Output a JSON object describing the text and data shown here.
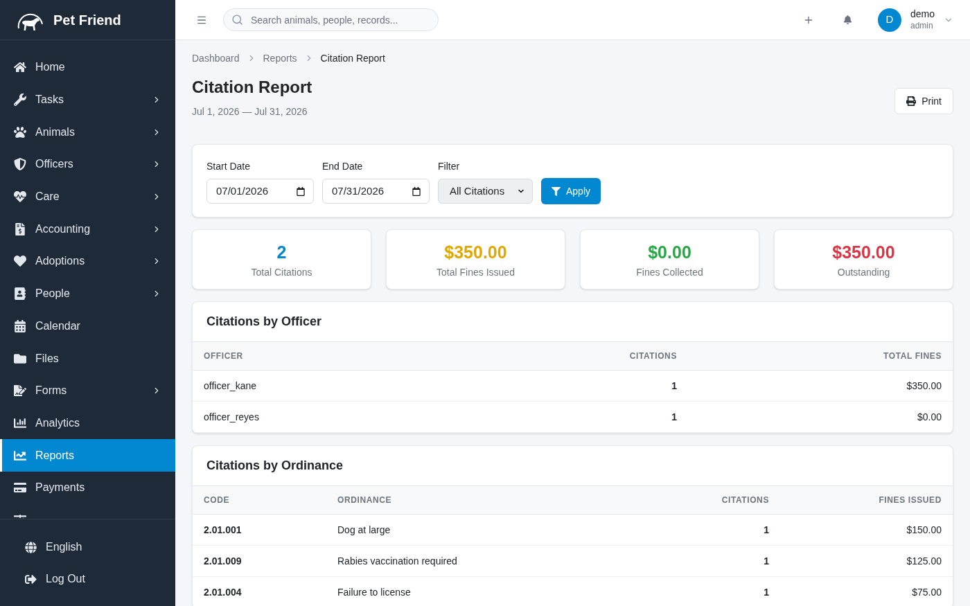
{
  "brand": {
    "name": "Pet Friend"
  },
  "sidebar": {
    "items": [
      {
        "label": "Home",
        "expandable": false,
        "selected": false
      },
      {
        "label": "Tasks",
        "expandable": true,
        "selected": false
      },
      {
        "label": "Animals",
        "expandable": true,
        "selected": false
      },
      {
        "label": "Officers",
        "expandable": true,
        "selected": false
      },
      {
        "label": "Care",
        "expandable": true,
        "selected": false
      },
      {
        "label": "Accounting",
        "expandable": true,
        "selected": false
      },
      {
        "label": "Adoptions",
        "expandable": true,
        "selected": false
      },
      {
        "label": "People",
        "expandable": true,
        "selected": false
      },
      {
        "label": "Calendar",
        "expandable": false,
        "selected": false
      },
      {
        "label": "Files",
        "expandable": false,
        "selected": false
      },
      {
        "label": "Forms",
        "expandable": true,
        "selected": false
      },
      {
        "label": "Analytics",
        "expandable": false,
        "selected": false
      },
      {
        "label": "Reports",
        "expandable": false,
        "selected": true
      },
      {
        "label": "Payments",
        "expandable": false,
        "selected": false
      },
      {
        "selected": false
      }
    ],
    "footer": [
      {
        "label": "English"
      },
      {
        "label": "Log Out"
      }
    ]
  },
  "topbar": {
    "search": {
      "placeholder": "Search animals, people, records..."
    },
    "user": {
      "initial": "D",
      "name": "demo",
      "role": "admin"
    }
  },
  "breadcrumb": [
    {
      "label": "Dashboard",
      "current": false
    },
    {
      "label": "Reports",
      "current": false
    },
    {
      "label": "Citation Report",
      "current": true
    }
  ],
  "page": {
    "title": "Citation Report",
    "subtitle": "Jul 1, 2026 — Jul 31, 2026",
    "print_button": "Print"
  },
  "filters": {
    "fields": [
      {
        "kind": "date",
        "label": "Start Date",
        "value": "07/01/2026"
      },
      {
        "kind": "date",
        "label": "End Date",
        "value": "07/31/2026"
      },
      {
        "kind": "select",
        "label": "Filter",
        "value": "All Citations"
      }
    ],
    "apply_button": "Apply"
  },
  "stats": [
    {
      "value": "2",
      "label": "Total Citations",
      "color": "#0288d1"
    },
    {
      "value": "$350.00",
      "label": "Total Fines Issued",
      "color": "#e0a800"
    },
    {
      "value": "$0.00",
      "label": "Fines Collected",
      "color": "#28a745"
    },
    {
      "value": "$350.00",
      "label": "Outstanding",
      "color": "#dc3545"
    }
  ],
  "officer_table": {
    "title": "Citations by Officer",
    "columns": [
      {
        "label": "OFFICER",
        "kind": "text"
      },
      {
        "label": "CITATIONS",
        "kind": "count"
      },
      {
        "label": "TOTAL FINES",
        "kind": "amount"
      }
    ],
    "rows": [
      [
        "officer_kane",
        "1",
        "$350.00"
      ],
      [
        "officer_reyes",
        "1",
        "$0.00"
      ]
    ]
  },
  "ordinance_table": {
    "title": "Citations by Ordinance",
    "columns": [
      {
        "label": "CODE",
        "kind": "code"
      },
      {
        "label": "ORDINANCE",
        "kind": "text"
      },
      {
        "label": "CITATIONS",
        "kind": "count"
      },
      {
        "label": "FINES ISSUED",
        "kind": "amount"
      }
    ],
    "rows": [
      [
        "2.01.001",
        "Dog at large",
        "1",
        "$150.00"
      ],
      [
        "2.01.009",
        "Rabies vaccination required",
        "1",
        "$125.00"
      ],
      [
        "2.01.004",
        "Failure to license",
        "1",
        "$75.00"
      ]
    ]
  }
}
